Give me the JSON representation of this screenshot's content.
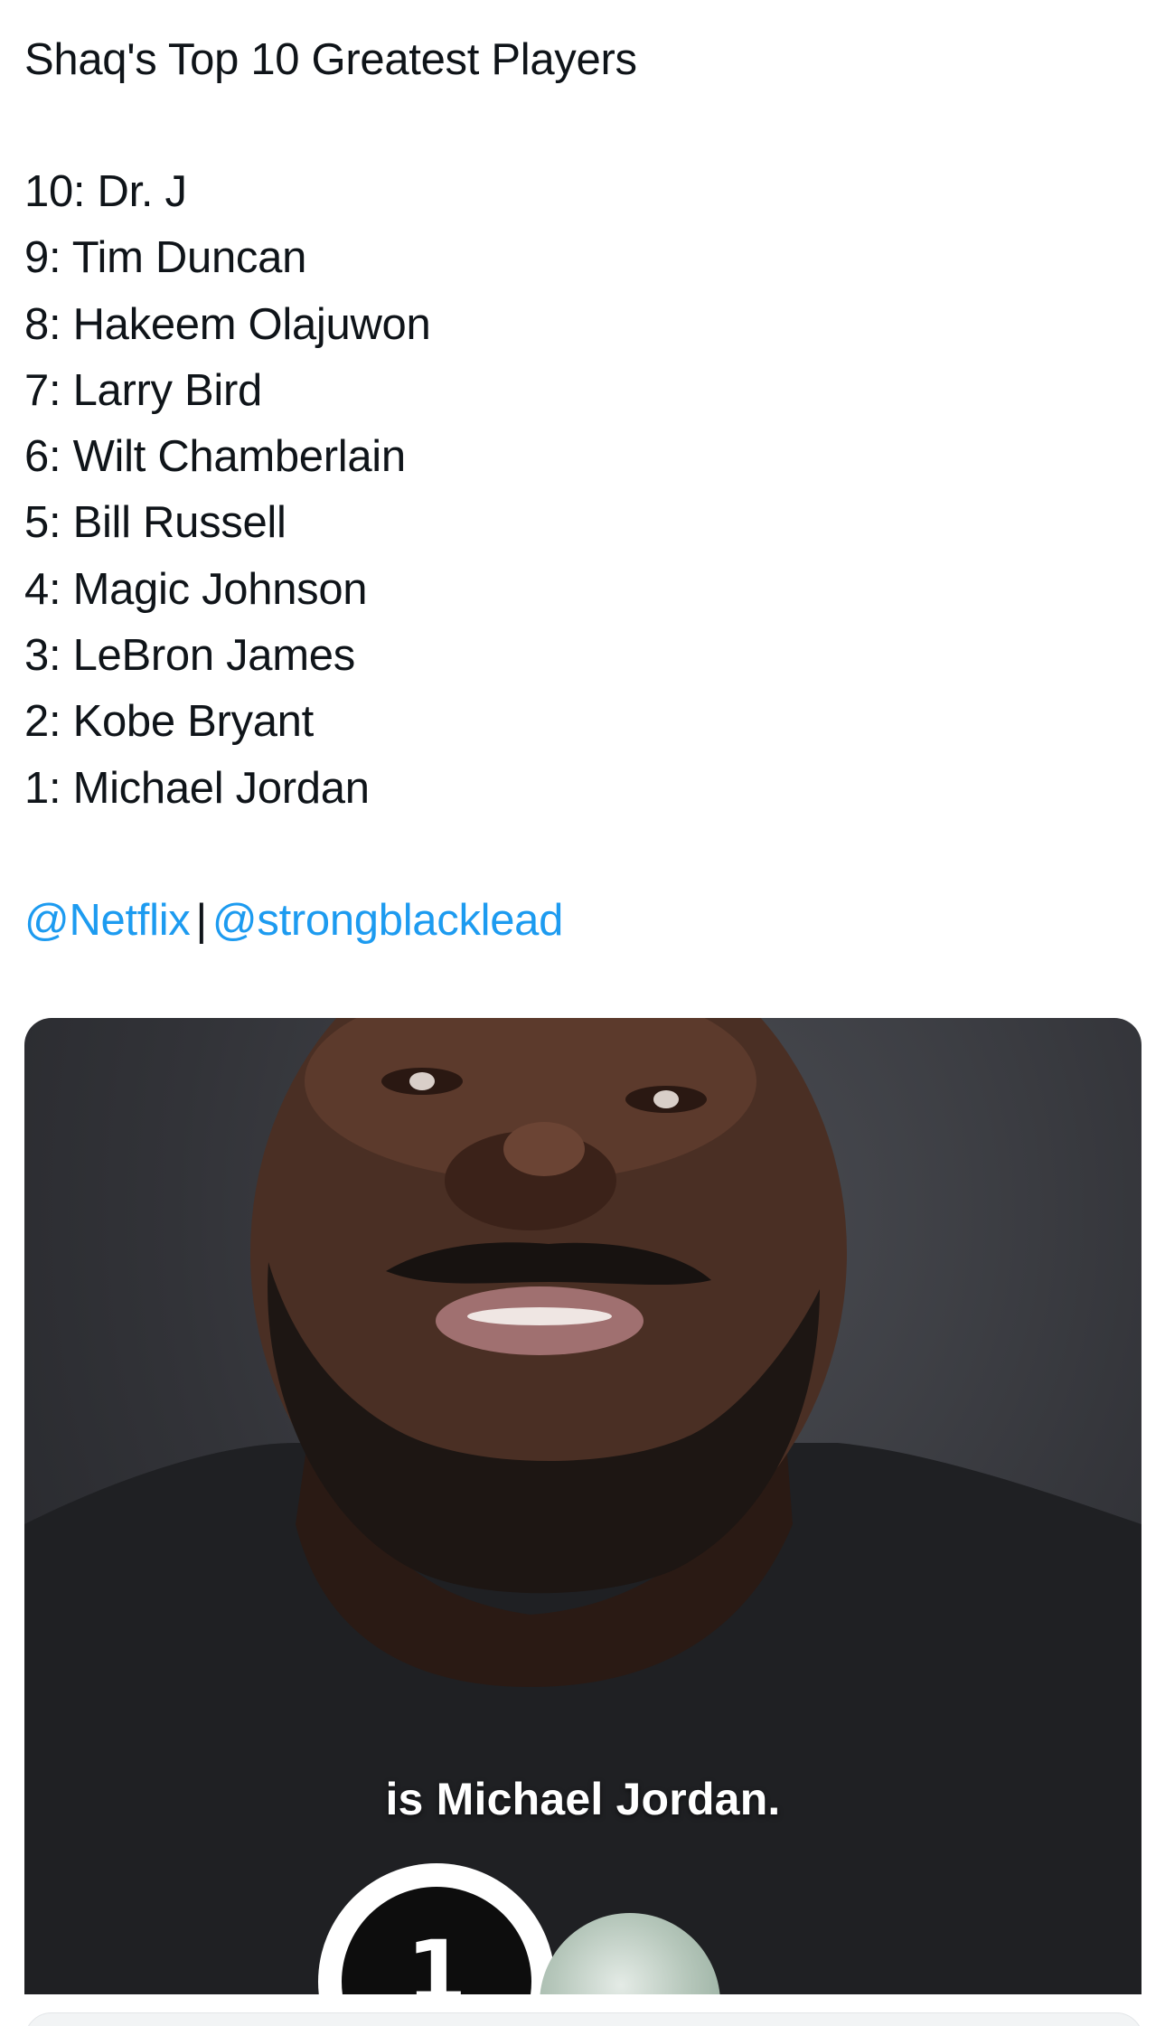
{
  "post": {
    "title": "Shaq's Top 10 Greatest Players",
    "rankings": [
      "10: Dr. J",
      "9: Tim Duncan",
      "8: Hakeem Olajuwon",
      "7: Larry Bird",
      "6: Wilt Chamberlain",
      "5: Bill Russell",
      "4: Magic Johnson",
      "3: LeBron James",
      "2: Kobe Bryant",
      "1: Michael Jordan"
    ],
    "mentions": {
      "first": "@Netflix",
      "separator": "|",
      "second": "@strongblacklead"
    }
  },
  "media": {
    "caption": "is Michael Jordan.",
    "badge_text": "1"
  },
  "colors": {
    "link": "#1d9bf0",
    "text": "#0f1419"
  }
}
